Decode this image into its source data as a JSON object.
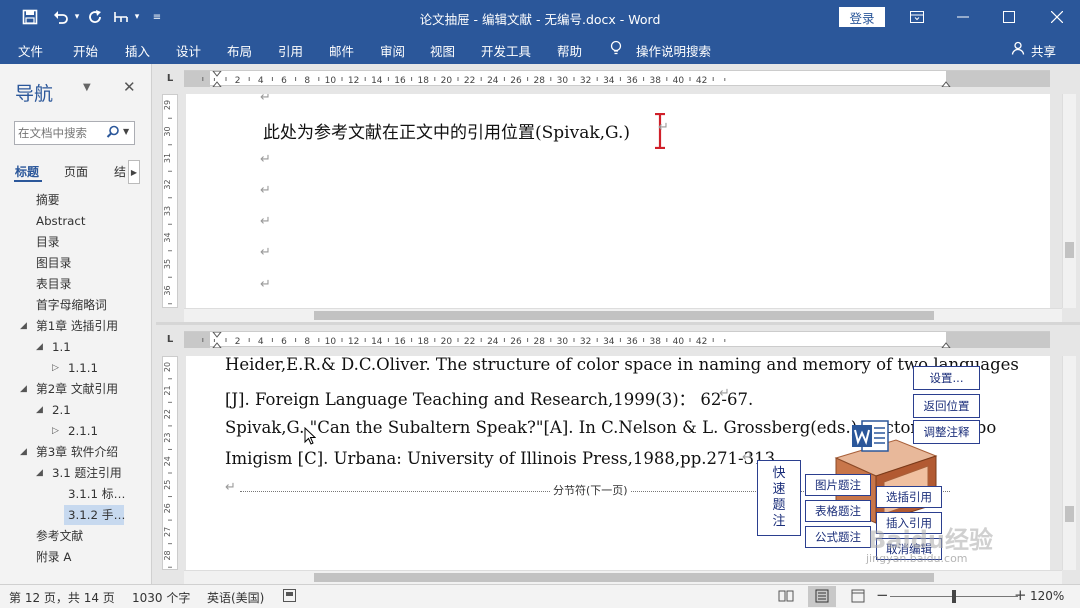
{
  "titlebar": {
    "title": "论文抽屉 - 编辑文献 - 无编号.docx  -  Word",
    "login": "登录"
  },
  "menu": {
    "items": [
      "文件",
      "开始",
      "插入",
      "设计",
      "布局",
      "引用",
      "邮件",
      "审阅",
      "视图",
      "开发工具",
      "帮助"
    ],
    "tell_me": "操作说明搜索",
    "share": "共享"
  },
  "nav": {
    "title": "导航",
    "search_placeholder": "在文档中搜索",
    "tabs": [
      "标题",
      "页面",
      "结"
    ],
    "tree": [
      {
        "label": "摘要",
        "level": 0,
        "arrow": ""
      },
      {
        "label": "Abstract",
        "level": 0,
        "arrow": ""
      },
      {
        "label": "目录",
        "level": 0,
        "arrow": ""
      },
      {
        "label": "图目录",
        "level": 0,
        "arrow": ""
      },
      {
        "label": "表目录",
        "level": 0,
        "arrow": ""
      },
      {
        "label": "首字母缩略词",
        "level": 0,
        "arrow": ""
      },
      {
        "label": "第1章 选插引用",
        "level": 0,
        "arrow": "◢"
      },
      {
        "label": "1.1",
        "level": 1,
        "arrow": "◢"
      },
      {
        "label": "1.1.1",
        "level": 2,
        "arrow": "▷"
      },
      {
        "label": "第2章 文献引用",
        "level": 0,
        "arrow": "◢"
      },
      {
        "label": "2.1",
        "level": 1,
        "arrow": "◢"
      },
      {
        "label": "2.1.1",
        "level": 2,
        "arrow": "▷"
      },
      {
        "label": "第3章 软件介绍",
        "level": 0,
        "arrow": "◢"
      },
      {
        "label": "3.1 题注引用",
        "level": 1,
        "arrow": "◢"
      },
      {
        "label": "3.1.1 标…",
        "level": 2,
        "arrow": ""
      },
      {
        "label": "3.1.2 手…",
        "level": 2,
        "arrow": "",
        "selected": true
      },
      {
        "label": "参考文献",
        "level": 0,
        "arrow": ""
      },
      {
        "label": "附录 A",
        "level": 0,
        "arrow": ""
      }
    ]
  },
  "ruler": {
    "numbers": [
      "2",
      "4",
      "6",
      "8",
      "10",
      "12",
      "14",
      "16",
      "18",
      "20",
      "22",
      "24",
      "26",
      "28",
      "30",
      "32",
      "34",
      "36",
      "38",
      "40",
      "42"
    ]
  },
  "top_pane": {
    "vruler": [
      "29",
      "30",
      "31",
      "32",
      "33",
      "34",
      "35",
      "36"
    ],
    "citation_line": "此处为参考文献在正文中的引用位置(Spivak,G.)"
  },
  "bottom_pane": {
    "vruler": [
      "20",
      "21",
      "22",
      "23",
      "24",
      "25",
      "26",
      "27",
      "28"
    ],
    "lines": [
      "Heider,E.R.& D.C.Oliver. The structure of color space in naming and memory of two languages",
      "[J]. Foreign Language Teaching and Research,1999(3)：  62-67.",
      "Spivak,G. \"Can the Subaltern Speak?\"[A]. In C.Nelson & L. Grossberg(eds.). Victoria. Limbo",
      "Imigism [C]. Urbana: University of Illinois Press,1988,pp.271-313."
    ],
    "section_break": "分节符(下一页)"
  },
  "plugin": {
    "right_buttons": [
      "设置...",
      "返回位置",
      "调整注释"
    ],
    "quick_caption": "快速题注",
    "caption_buttons": [
      "图片题注",
      "表格题注",
      "公式题注"
    ],
    "cite_buttons": [
      "选插引用",
      "插入引用",
      "取消编辑"
    ]
  },
  "statusbar": {
    "page": "第 12 页，共 14 页",
    "words": "1030 个字",
    "language": "英语(美国)",
    "zoom": "120%"
  },
  "watermark": {
    "brand": "Baidu经验",
    "url": "jingyan.baidu.com"
  },
  "colors": {
    "ribbon": "#2b579a",
    "cursor": "#d0202a",
    "plugin_border": "#2b3f8f"
  }
}
